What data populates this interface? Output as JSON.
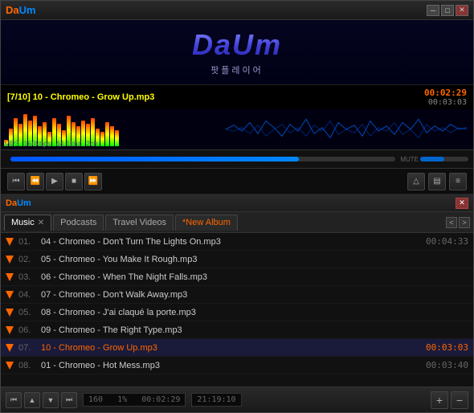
{
  "window": {
    "title": "Daum",
    "logo_text": "Da",
    "logo_text2": "Um"
  },
  "titlebar": {
    "minimize_label": "─",
    "maximize_label": "□",
    "close_label": "✕"
  },
  "logo": {
    "text": "DaUm",
    "subtitle": "팟플레이어"
  },
  "track": {
    "info": "[7/10] 10 - Chromeo - Grow Up.mp3",
    "time_elapsed": "00:02:29",
    "time_total": "00:03:03",
    "format": "MP3",
    "bitrate": "160kbps",
    "sample_rate": "44.1khz",
    "channels": "2ch"
  },
  "controls": {
    "prev": "⏮",
    "prev_frame": "⏪",
    "play": "▶",
    "stop": "■",
    "next_frame": "⏩",
    "next": "⏭",
    "mute": "MUTE",
    "expand": "△",
    "list": "☰",
    "eq": "≡"
  },
  "tabs": [
    {
      "label": "Music",
      "active": true,
      "closeable": true
    },
    {
      "label": "Podcasts",
      "active": false,
      "closeable": false
    },
    {
      "label": "Travel Videos",
      "active": false,
      "closeable": false
    },
    {
      "label": "*New Album",
      "active": false,
      "closeable": false
    }
  ],
  "playlist": [
    {
      "number": "01.",
      "title": "04 - Chromeo - Don't Turn The Lights On.mp3",
      "duration": "00:04:33",
      "active": false
    },
    {
      "number": "02.",
      "title": "05 - Chromeo - You Make It Rough.mp3",
      "duration": "",
      "active": false
    },
    {
      "number": "03.",
      "title": "06 - Chromeo - When The Night Falls.mp3",
      "duration": "",
      "active": false
    },
    {
      "number": "04.",
      "title": "07 - Chromeo - Don't Walk Away.mp3",
      "duration": "",
      "active": false
    },
    {
      "number": "05.",
      "title": "08 - Chromeo - J'ai claqué la porte.mp3",
      "duration": "",
      "active": false
    },
    {
      "number": "06.",
      "title": "09 - Chromeo - The Right Type.mp3",
      "duration": "",
      "active": false
    },
    {
      "number": "07.",
      "title": "10 - Chromeo - Grow Up.mp3",
      "duration": "00:03:03",
      "active": true
    },
    {
      "number": "08.",
      "title": "01 - Chromeo - Hot Mess.mp3",
      "duration": "00:03:40",
      "active": false
    }
  ],
  "bottom": {
    "speed": "160",
    "speed_unit": "1%",
    "time": "00:02:29",
    "date": "21:19:10",
    "add_label": "+",
    "remove_label": "−"
  },
  "viz_bars": [
    8,
    22,
    35,
    28,
    40,
    32,
    38,
    25,
    30,
    18,
    35,
    28,
    20,
    38,
    30,
    25,
    32,
    28,
    35,
    22,
    18,
    30,
    25,
    20
  ]
}
